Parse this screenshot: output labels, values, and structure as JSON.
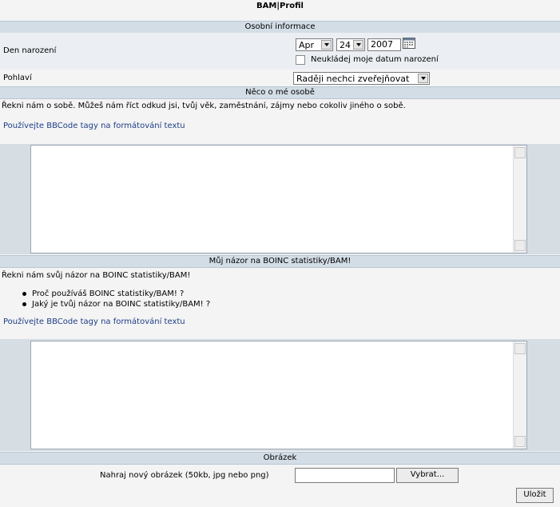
{
  "page": {
    "title": "BAM|Profil"
  },
  "personal": {
    "header": "Osobní informace",
    "birth_label": "Den narození",
    "month": "Apr",
    "day": "24",
    "year": "2007",
    "dont_save_label": "Neukládej moje datum narození",
    "gender_label": "Pohlaví",
    "gender_value": "Raději nechci zveřejňovat"
  },
  "about": {
    "header": "Něco o mé osobě",
    "intro": "Řekni nám o sobě. Můžeš nám říct odkud jsi, tvůj věk, zaměstnání, zájmy nebo cokoliv jiného o sobě.",
    "bbcode_link": "Používejte BBCode tagy na formátování textu",
    "text": ""
  },
  "opinion": {
    "header": "Můj názor na BOINC statistiky/BAM!",
    "intro": "Řekni nám svůj názor na BOINC statistiky/BAM!",
    "bullets": [
      "Proč používáš BOINC statistiky/BAM! ?",
      "Jaký je tvůj názor na BOINC statistiky/BAM! ?"
    ],
    "bbcode_link": "Používejte BBCode tagy na formátování textu",
    "text": ""
  },
  "image": {
    "header": "Obrázek",
    "upload_label": "Nahraj nový obrázek (50kb, jpg nebo png)",
    "file_value": "",
    "browse_label": "Vybrat..."
  },
  "actions": {
    "save_label": "Uložit"
  }
}
